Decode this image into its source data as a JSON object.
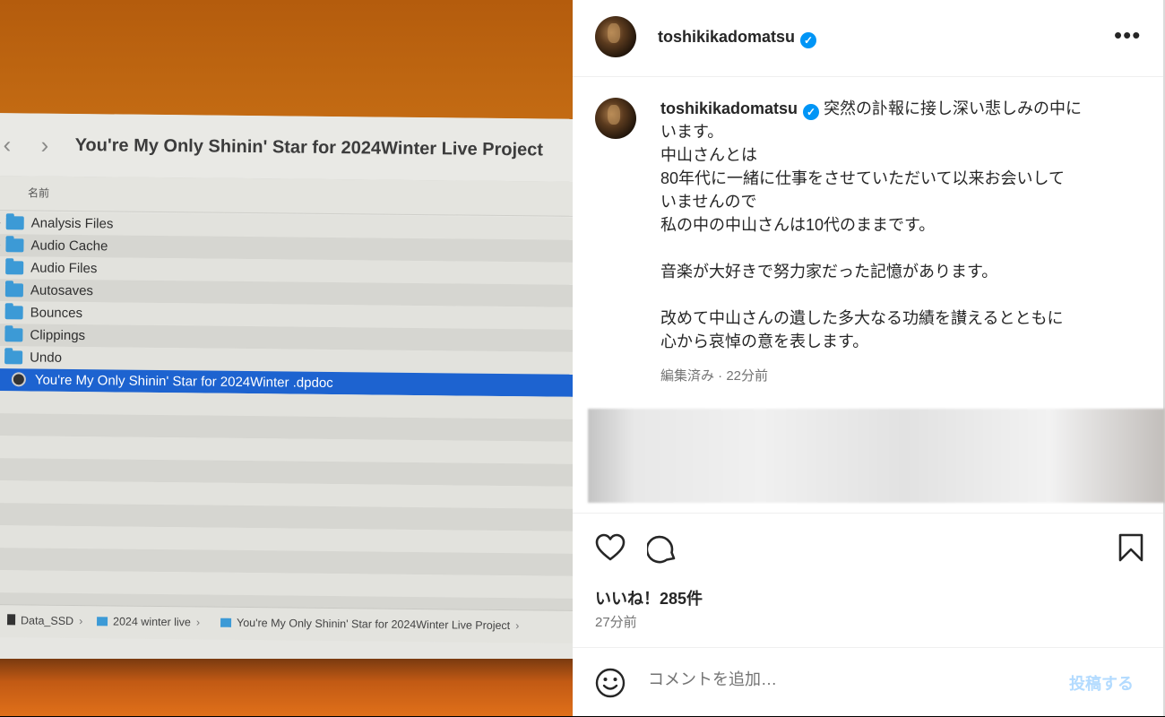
{
  "photo": {
    "finder_title": "You're My Only Shinin' Star for 2024Winter Live Project",
    "back_glyph": "‹",
    "forward_glyph": "›",
    "column_header": "名前",
    "folders": [
      "Analysis Files",
      "Audio Cache",
      "Audio Files",
      "Autosaves",
      "Bounces",
      "Clippings",
      "Undo"
    ],
    "selected_file": "You're My Only Shinin' Star for 2024Winter .dpdoc",
    "path": [
      "Data_SSD",
      "2024 winter live",
      "You're My Only Shinin' Star for 2024Winter Live Project"
    ],
    "selection_color": "#1d63d0"
  },
  "post": {
    "username": "toshikikadomatsu",
    "verified_glyph": "✓",
    "more_glyph": "•••",
    "caption_lines": [
      "突然の訃報に接し深い悲しみの中に",
      "います。",
      "中山さんとは",
      "80年代に一緒に仕事をさせていただいて以来お会いして",
      "いませんので",
      "私の中の中山さんは10代のままです。",
      "",
      "音楽が大好きで努力家だった記憶があります。",
      "",
      "改めて中山さんの遺した多大なる功績を讃えるとともに",
      "心から哀悼の意を表します。"
    ],
    "caption_meta": "編集済み · 22分前",
    "likes": "いいね！285件",
    "time": "27分前",
    "comment_placeholder": "コメントを追加…",
    "post_label": "投稿する",
    "accent_color": "#0095f6"
  },
  "icons": {
    "like": "heart-icon",
    "comment": "comment-icon",
    "save": "bookmark-icon",
    "emoji": "emoji-icon"
  }
}
